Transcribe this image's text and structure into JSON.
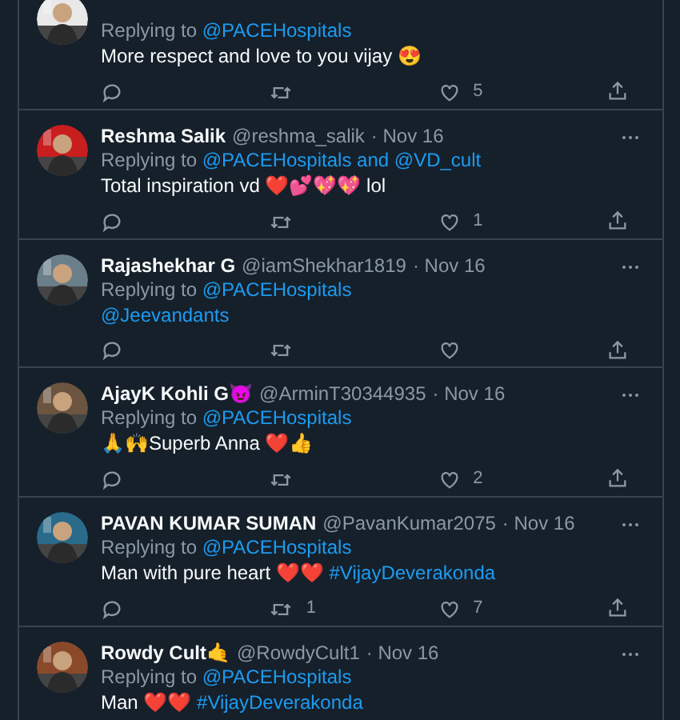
{
  "tweets": [
    {
      "reply_label": "Replying to",
      "reply_to": [
        {
          "kind": "link",
          "text": "@PACEHospitals"
        }
      ],
      "body": [
        {
          "kind": "text",
          "text": "More respect and love to you vijay 😍"
        }
      ],
      "avatar": {
        "kind": "picture"
      },
      "actions": [
        {
          "kind": "reply"
        },
        {
          "kind": "retweet"
        },
        {
          "kind": "like",
          "count": "5"
        },
        {
          "kind": "share"
        }
      ]
    },
    {
      "name": "Reshma Salik",
      "handle": "@reshma_salik",
      "date": "· Nov 16",
      "reply_label": "Replying to",
      "reply_to": [
        {
          "kind": "link",
          "text": "@PACEHospitals and @VD_cult"
        }
      ],
      "body": [
        {
          "kind": "text",
          "text": "Total inspiration vd ❤️💕💖💖 lol"
        }
      ],
      "avatar": {
        "kind": "picture"
      },
      "actions": [
        {
          "kind": "reply"
        },
        {
          "kind": "retweet"
        },
        {
          "kind": "like",
          "count": "1"
        },
        {
          "kind": "share"
        }
      ]
    },
    {
      "name": "Rajashekhar G",
      "handle": "@iamShekhar1819",
      "date": "· Nov 16",
      "reply_label": "Replying to",
      "reply_to": [
        {
          "kind": "link",
          "text": "@PACEHospitals"
        }
      ],
      "body": [
        {
          "kind": "link",
          "text": "@Jeevandants"
        }
      ],
      "avatar": {
        "kind": "picture"
      },
      "actions": [
        {
          "kind": "reply"
        },
        {
          "kind": "retweet"
        },
        {
          "kind": "like"
        },
        {
          "kind": "share"
        }
      ]
    },
    {
      "name": "AjayK Kohli G😈",
      "handle": "@ArminT30344935",
      "date": "· Nov 16",
      "reply_label": "Replying to",
      "reply_to": [
        {
          "kind": "link",
          "text": "@PACEHospitals"
        }
      ],
      "body": [
        {
          "kind": "text",
          "text": "🙏🙌Superb Anna ❤️👍"
        }
      ],
      "avatar": {
        "kind": "picture"
      },
      "actions": [
        {
          "kind": "reply"
        },
        {
          "kind": "retweet"
        },
        {
          "kind": "like",
          "count": "2"
        },
        {
          "kind": "share"
        }
      ]
    },
    {
      "name": "PAVAN KUMAR SUMAN",
      "handle": "@PavanKumar2075",
      "date": "· Nov 16",
      "reply_label": "Replying to",
      "reply_to": [
        {
          "kind": "link",
          "text": "@PACEHospitals"
        }
      ],
      "body": [
        {
          "kind": "text",
          "text": "Man with pure heart ❤️❤️ "
        },
        {
          "kind": "link",
          "text": "#VijayDeverakonda"
        }
      ],
      "avatar": {
        "kind": "picture"
      },
      "actions": [
        {
          "kind": "reply"
        },
        {
          "kind": "retweet",
          "count": "1"
        },
        {
          "kind": "like",
          "count": "7"
        },
        {
          "kind": "share"
        }
      ]
    },
    {
      "name": "Rowdy Cult🤙",
      "handle": "@RowdyCult1",
      "date": "· Nov 16",
      "reply_label": "Replying to",
      "reply_to": [
        {
          "kind": "link",
          "text": "@PACEHospitals"
        }
      ],
      "body": [
        {
          "kind": "text",
          "text": "Man ❤️❤️ "
        },
        {
          "kind": "link",
          "text": "#VijayDeverakonda"
        }
      ],
      "avatar": {
        "kind": "picture"
      }
    }
  ]
}
